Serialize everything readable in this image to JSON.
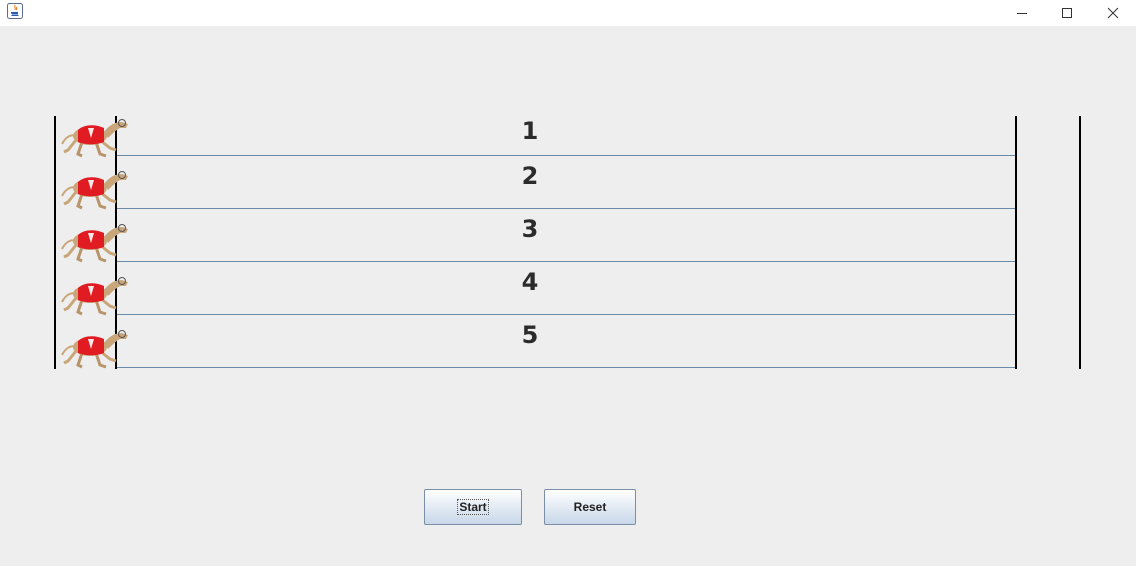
{
  "window": {
    "title": "",
    "controls": [
      "minimize-icon",
      "maximize-icon",
      "close-icon"
    ]
  },
  "race": {
    "lanes": [
      {
        "number": "1",
        "runner": "greyhound-icon"
      },
      {
        "number": "2",
        "runner": "greyhound-icon"
      },
      {
        "number": "3",
        "runner": "greyhound-icon"
      },
      {
        "number": "4",
        "runner": "greyhound-icon"
      },
      {
        "number": "5",
        "runner": "greyhound-icon"
      }
    ]
  },
  "controls": {
    "start_label": "Start",
    "reset_label": "Reset"
  },
  "colors": {
    "background": "#eeeeee",
    "lane_separator": "#6b8aa8",
    "dog_jacket": "#e11b22"
  }
}
